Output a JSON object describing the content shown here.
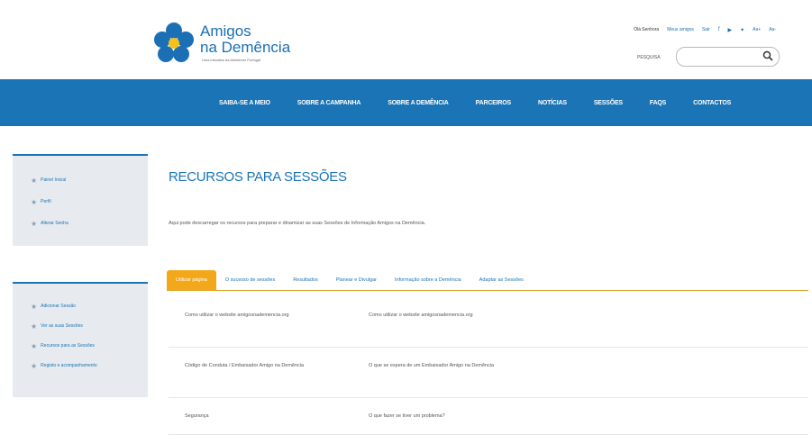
{
  "brand": {
    "name_line1": "Amigos",
    "name_line2": "na Demência",
    "tagline": "Uma iniciativa da Alzheimer Portugal",
    "logo_color": "#1b6fb4",
    "accent_yellow": "#f3a81c"
  },
  "toplinks": {
    "items": [
      "Olá Senhora",
      "Meus amigos",
      "Sair"
    ],
    "social_icons": [
      "facebook-icon",
      "youtube-icon",
      "twitter-icon"
    ],
    "font_controls": [
      "Aa+",
      "Aa-"
    ]
  },
  "search": {
    "label": "PESQUISA",
    "placeholder": ""
  },
  "nav": {
    "bg_color": "#1a74b5",
    "items": [
      "SAIBA-SE A MEIO",
      "SOBRE A CAMPANHA",
      "SOBRE A DEMÊNCIA",
      "PARCEIROS",
      "NOTÍCIAS",
      "SESSÕES",
      "FAQS",
      "CONTACTOS"
    ]
  },
  "sidebar": {
    "profile_menu": [
      "Painel Inicial",
      "Perfil",
      "Alterar Senha"
    ],
    "session_menu": [
      "Adicionar Sessão",
      "Ver as suas Sessões",
      "Recursos para as Sessões",
      "Registo e acompanhamento"
    ]
  },
  "main": {
    "title": "RECURSOS PARA SESSÕES",
    "intro": "Aqui pode descarregar os recursos para preparar e dinamizar as suas Sessões de Informação Amigos na Demência.",
    "tabs": [
      "Utilizar página",
      "O sucesso de sessões",
      "Resultados",
      "Planear e Divulgar",
      "Informação sobre a Demência",
      "Adaptar as Sessões"
    ],
    "active_tab": 0,
    "rows": [
      {
        "topic": "Como utilizar o website amigosnademencia.org",
        "description": "Como utilizar o website amigosnademencia.org"
      },
      {
        "topic": "Código de Conduta / Embaixador Amigo na Demência",
        "description": "O que se espera de um Embaixador Amigo na Demência"
      },
      {
        "topic": "Segurança",
        "description": "O que fazer se tiver um problema?"
      }
    ]
  }
}
